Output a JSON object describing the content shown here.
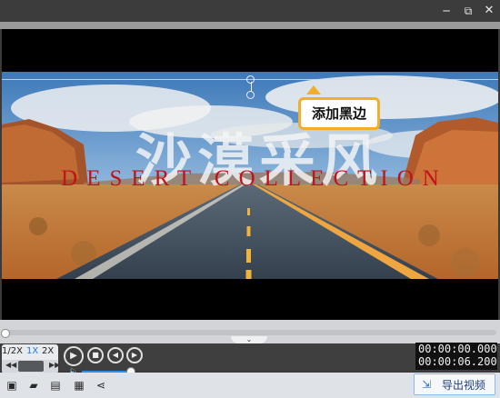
{
  "window": {
    "minimize": "─",
    "restore": "⧉",
    "close": "✕"
  },
  "preview": {
    "tooltip": "添加黑边",
    "title_cn": "沙漠采风",
    "title_en": "DESERT COLLECTION"
  },
  "timeline": {
    "collapse_icon": "chevron-down-icon",
    "collapse_glyph": "⌄",
    "position_fraction": 0.0
  },
  "playback": {
    "speeds": [
      "1/2X",
      "1X",
      "2X"
    ],
    "selected_speed": "1X",
    "rewind_glyph": "◀◀",
    "forward_glyph": "▶▶",
    "play_glyph": "▶",
    "stop_glyph": "■",
    "prev_glyph": "◀",
    "next_glyph": "▶",
    "volume_glyph": "🔈",
    "volume_level": 1.0,
    "current_time": "00:00:00.000",
    "total_time": "00:00:06.200"
  },
  "toolbar": {
    "icons": [
      "new-project-icon",
      "open-folder-icon",
      "save-icon",
      "save-as-icon",
      "share-icon"
    ],
    "glyphs": [
      "▣",
      "▰",
      "▤",
      "▦",
      "⋖"
    ],
    "export_label": "导出视频",
    "export_glyph": "⇲"
  },
  "colors": {
    "accent": "#f2ad2b",
    "title_red": "#c2121a",
    "link_blue": "#1c7ce0"
  }
}
